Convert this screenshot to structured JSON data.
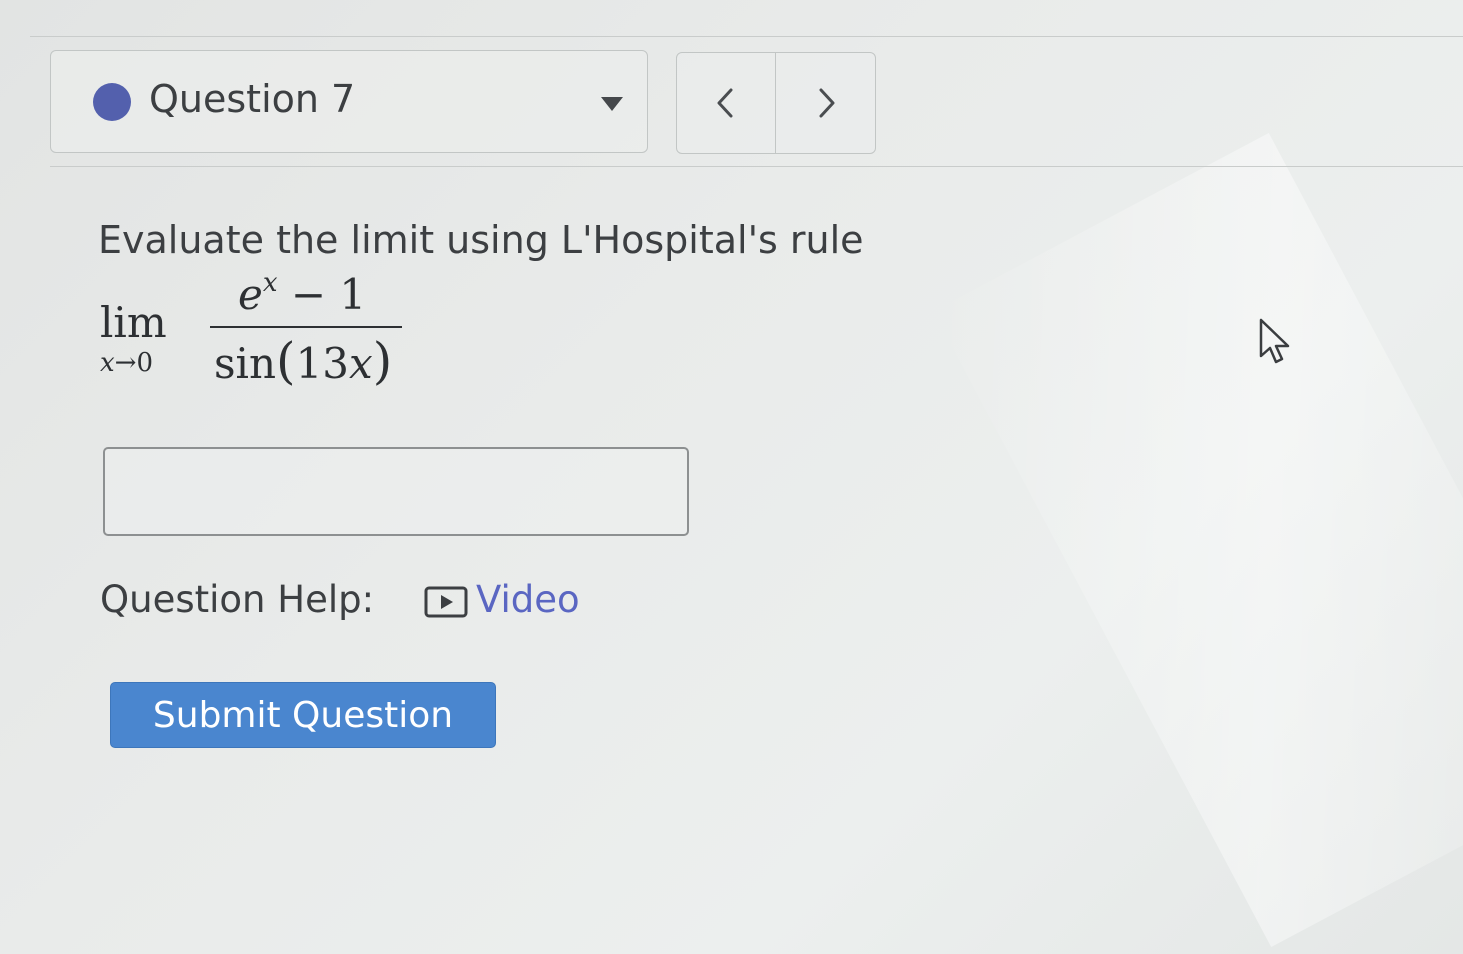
{
  "header": {
    "question_label": "Question 7",
    "status_color": "#5360ad",
    "prev_icon": "chevron-left-icon",
    "next_icon": "chevron-right-icon"
  },
  "question": {
    "prompt": "Evaluate the limit using L'Hospital's rule",
    "expression": {
      "lim": "lim",
      "lim_var": "x",
      "lim_arrow": "→",
      "lim_target": "0",
      "numerator_base": "e",
      "numerator_exp": "x",
      "numerator_rest": " − 1",
      "denominator_func": "sin",
      "denominator_arg_num": "13",
      "denominator_arg_var": "x"
    }
  },
  "answer": {
    "value": "",
    "placeholder": ""
  },
  "help": {
    "label": "Question Help:",
    "video_label": "Video",
    "video_icon": "play-icon",
    "link_color": "#5a66c2"
  },
  "submit": {
    "label": "Submit Question",
    "color": "#4a86cf"
  }
}
